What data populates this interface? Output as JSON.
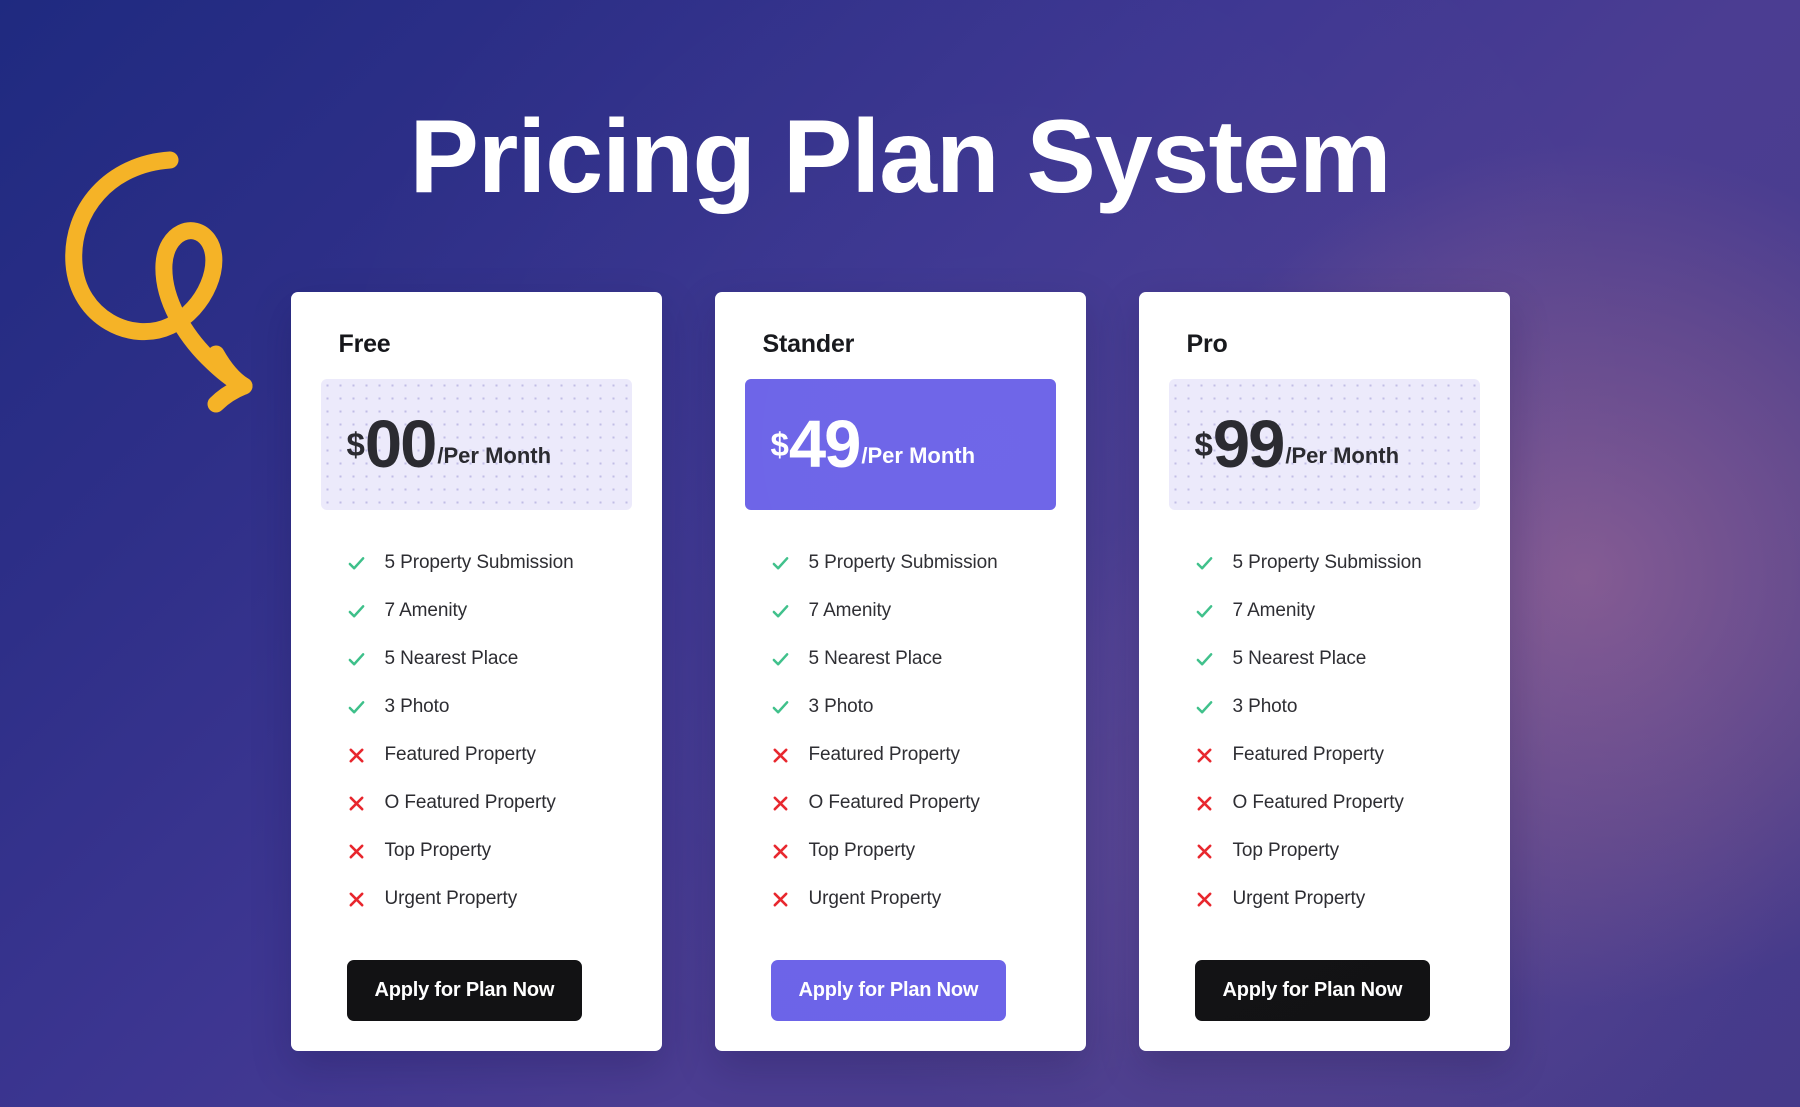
{
  "page": {
    "title": "Pricing Plan System",
    "background_colors": {
      "gradient_start": "#1f2a80",
      "gradient_mid": "#4b3d92",
      "gradient_end": "#453a8a",
      "glow": "#7a5a78"
    },
    "decoration": {
      "arrow_icon": "curly-arrow-icon",
      "arrow_color": "#F5B327"
    }
  },
  "plans": [
    {
      "name": "Free",
      "currency": "$",
      "amount": "00",
      "period": "/Per Month",
      "price_box_style": "light",
      "price_box_color": "#eceafb",
      "cta_label": "Apply for Plan Now",
      "cta_style": "dark",
      "cta_color": "#121214",
      "features": [
        {
          "label": "5 Property Submission",
          "included": true
        },
        {
          "label": "7 Amenity",
          "included": true
        },
        {
          "label": "5 Nearest Place",
          "included": true
        },
        {
          "label": "3 Photo",
          "included": true
        },
        {
          "label": "Featured Property",
          "included": false
        },
        {
          "label": "O Featured Property",
          "included": false
        },
        {
          "label": "Top Property",
          "included": false
        },
        {
          "label": "Urgent Property",
          "included": false
        }
      ]
    },
    {
      "name": "Stander",
      "currency": "$",
      "amount": "49",
      "period": "/Per Month",
      "price_box_style": "purple",
      "price_box_color": "#6c63e8",
      "cta_label": "Apply for Plan Now",
      "cta_style": "purple",
      "cta_color": "#6c63e8",
      "features": [
        {
          "label": "5 Property Submission",
          "included": true
        },
        {
          "label": "7 Amenity",
          "included": true
        },
        {
          "label": "5 Nearest Place",
          "included": true
        },
        {
          "label": "3 Photo",
          "included": true
        },
        {
          "label": "Featured Property",
          "included": false
        },
        {
          "label": "O Featured Property",
          "included": false
        },
        {
          "label": "Top Property",
          "included": false
        },
        {
          "label": "Urgent Property",
          "included": false
        }
      ]
    },
    {
      "name": "Pro",
      "currency": "$",
      "amount": "99",
      "period": "/Per Month",
      "price_box_style": "light",
      "price_box_color": "#eceafb",
      "cta_label": "Apply for Plan Now",
      "cta_style": "dark",
      "cta_color": "#121214",
      "features": [
        {
          "label": "5 Property Submission",
          "included": true
        },
        {
          "label": "7 Amenity",
          "included": true
        },
        {
          "label": "5 Nearest Place",
          "included": true
        },
        {
          "label": "3 Photo",
          "included": true
        },
        {
          "label": "Featured Property",
          "included": false
        },
        {
          "label": "O Featured Property",
          "included": false
        },
        {
          "label": "Top Property",
          "included": false
        },
        {
          "label": "Urgent Property",
          "included": false
        }
      ]
    }
  ],
  "icons": {
    "check": "check-icon",
    "cross": "cross-icon",
    "check_color": "#3ec08a",
    "cross_color": "#e8262d"
  }
}
